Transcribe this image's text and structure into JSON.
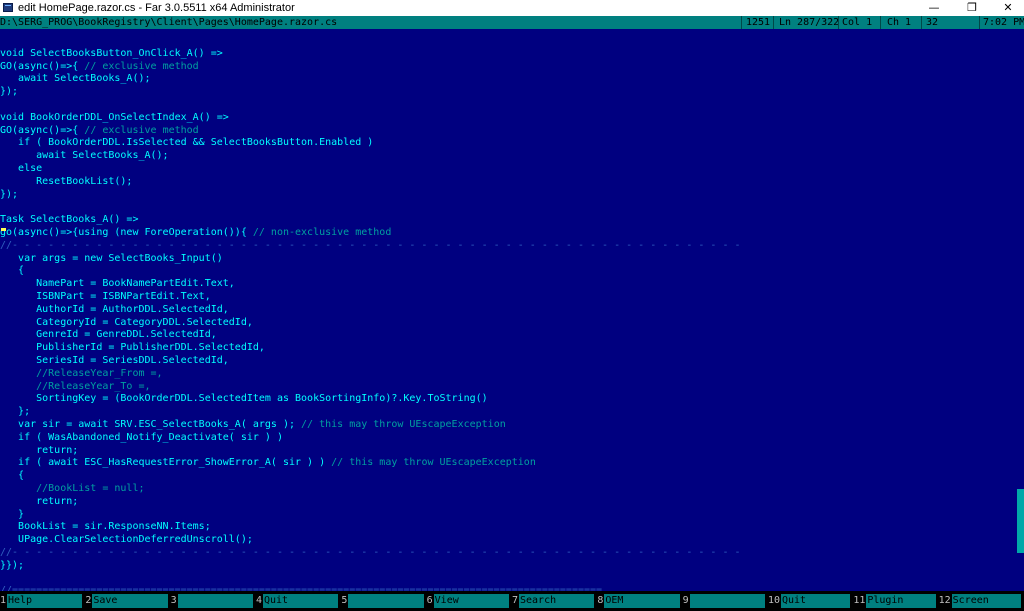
{
  "window": {
    "title": "edit HomePage.razor.cs - Far 3.0.5511 x64 Administrator",
    "minimize_glyph": "—",
    "maximize_glyph": "❐",
    "close_glyph": "✕"
  },
  "status": {
    "path": "D:\\SERG_PROG\\BookRegistry\\Client\\Pages\\HomePage.razor.cs",
    "codepage": "1251",
    "line": "Ln 287/322",
    "col": "Col 1",
    "char": "Ch 1",
    "code": "32",
    "time": "7:02 PM"
  },
  "editor": {
    "lines": [
      {
        "t": "",
        "k": "code"
      },
      {
        "t": "void SelectBooksButton_OnClick_A() =>",
        "k": "code"
      },
      {
        "t": "GO(async()=>{ ",
        "k": "code",
        "c": "// exclusive method"
      },
      {
        "t": "   await SelectBooks_A();",
        "k": "code"
      },
      {
        "t": "});",
        "k": "code"
      },
      {
        "t": "",
        "k": "code"
      },
      {
        "t": "void BookOrderDDL_OnSelectIndex_A() =>",
        "k": "code"
      },
      {
        "t": "GO(async()=>{ ",
        "k": "code",
        "c": "// exclusive method"
      },
      {
        "t": "   if ( BookOrderDDL.IsSelected && SelectBooksButton.Enabled )",
        "k": "code"
      },
      {
        "t": "      await SelectBooks_A();",
        "k": "code"
      },
      {
        "t": "   else",
        "k": "code"
      },
      {
        "t": "      ResetBookList();",
        "k": "code"
      },
      {
        "t": "});",
        "k": "code"
      },
      {
        "t": "",
        "k": "code"
      },
      {
        "t": "Task SelectBooks_A() =>",
        "k": "code"
      },
      {
        "t": "go(async()=>{using (new ForeOperation()){ ",
        "k": "code",
        "c": "// non-exclusive method"
      },
      {
        "t": "//- - - - - - - - - - - - - - - - - - - - - - - - - - - - - - - - - - - - - - - - - - - - - - - - - - - - - - - - - - - - -",
        "k": "sep"
      },
      {
        "t": "   var args = new SelectBooks_Input()",
        "k": "code"
      },
      {
        "t": "   {",
        "k": "code"
      },
      {
        "t": "      NamePart = BookNamePartEdit.Text,",
        "k": "code"
      },
      {
        "t": "      ISBNPart = ISBNPartEdit.Text,",
        "k": "code"
      },
      {
        "t": "      AuthorId = AuthorDDL.SelectedId,",
        "k": "code"
      },
      {
        "t": "      CategoryId = CategoryDDL.SelectedId,",
        "k": "code"
      },
      {
        "t": "      GenreId = GenreDDL.SelectedId,",
        "k": "code"
      },
      {
        "t": "      PublisherId = PublisherDDL.SelectedId,",
        "k": "code"
      },
      {
        "t": "      SeriesId = SeriesDDL.SelectedId,",
        "k": "code"
      },
      {
        "t": "      ",
        "k": "code",
        "c": "//ReleaseYear_From =,"
      },
      {
        "t": "      ",
        "k": "code",
        "c": "//ReleaseYear_To =,"
      },
      {
        "t": "      SortingKey = (BookOrderDDL.SelectedItem as BookSortingInfo)?.Key.ToString()",
        "k": "code"
      },
      {
        "t": "   };",
        "k": "code"
      },
      {
        "t": "   var sir = await SRV.ESC_SelectBooks_A( args ); ",
        "k": "code",
        "c": "// this may throw UEscapeException"
      },
      {
        "t": "   if ( WasAbandoned_Notify_Deactivate( sir ) )",
        "k": "code"
      },
      {
        "t": "      return;",
        "k": "code"
      },
      {
        "t": "   if ( await ESC_HasRequestError_ShowError_A( sir ) ) ",
        "k": "code",
        "c": "// this may throw UEscapeException"
      },
      {
        "t": "   {",
        "k": "code"
      },
      {
        "t": "      ",
        "k": "code",
        "c": "//BookList = null;"
      },
      {
        "t": "      return;",
        "k": "code"
      },
      {
        "t": "   }",
        "k": "code"
      },
      {
        "t": "   BookList = sir.ResponseNN.Items;",
        "k": "code"
      },
      {
        "t": "   UPage.ClearSelectionDeferredUnscroll();",
        "k": "code"
      },
      {
        "t": "//- - - - - - - - - - - - - - - - - - - - - - - - - - - - - - - - - - - - - - - - - - - - - - - - - - - - - - - - - - - - -",
        "k": "sep"
      },
      {
        "t": "}});",
        "k": "code"
      },
      {
        "t": "",
        "k": "code"
      },
      {
        "t": "//==================================================================================================",
        "k": "sep"
      }
    ]
  },
  "keybar": [
    {
      "num": "1",
      "label": "Help"
    },
    {
      "num": "2",
      "label": "Save"
    },
    {
      "num": "3",
      "label": ""
    },
    {
      "num": "4",
      "label": "Quit"
    },
    {
      "num": "5",
      "label": ""
    },
    {
      "num": "6",
      "label": "View"
    },
    {
      "num": "7",
      "label": "Search"
    },
    {
      "num": "8",
      "label": "OEM"
    },
    {
      "num": "9",
      "label": ""
    },
    {
      "num": "10",
      "label": "Quit"
    },
    {
      "num": "11",
      "label": "Plugin"
    },
    {
      "num": "12",
      "label": "Screen"
    }
  ],
  "colors": {
    "editor_bg": "#000080",
    "code_text": "#00ffff",
    "comment_text": "#00a0a0",
    "statusbar_bg": "#008080",
    "keybar_label_bg": "#008080"
  }
}
